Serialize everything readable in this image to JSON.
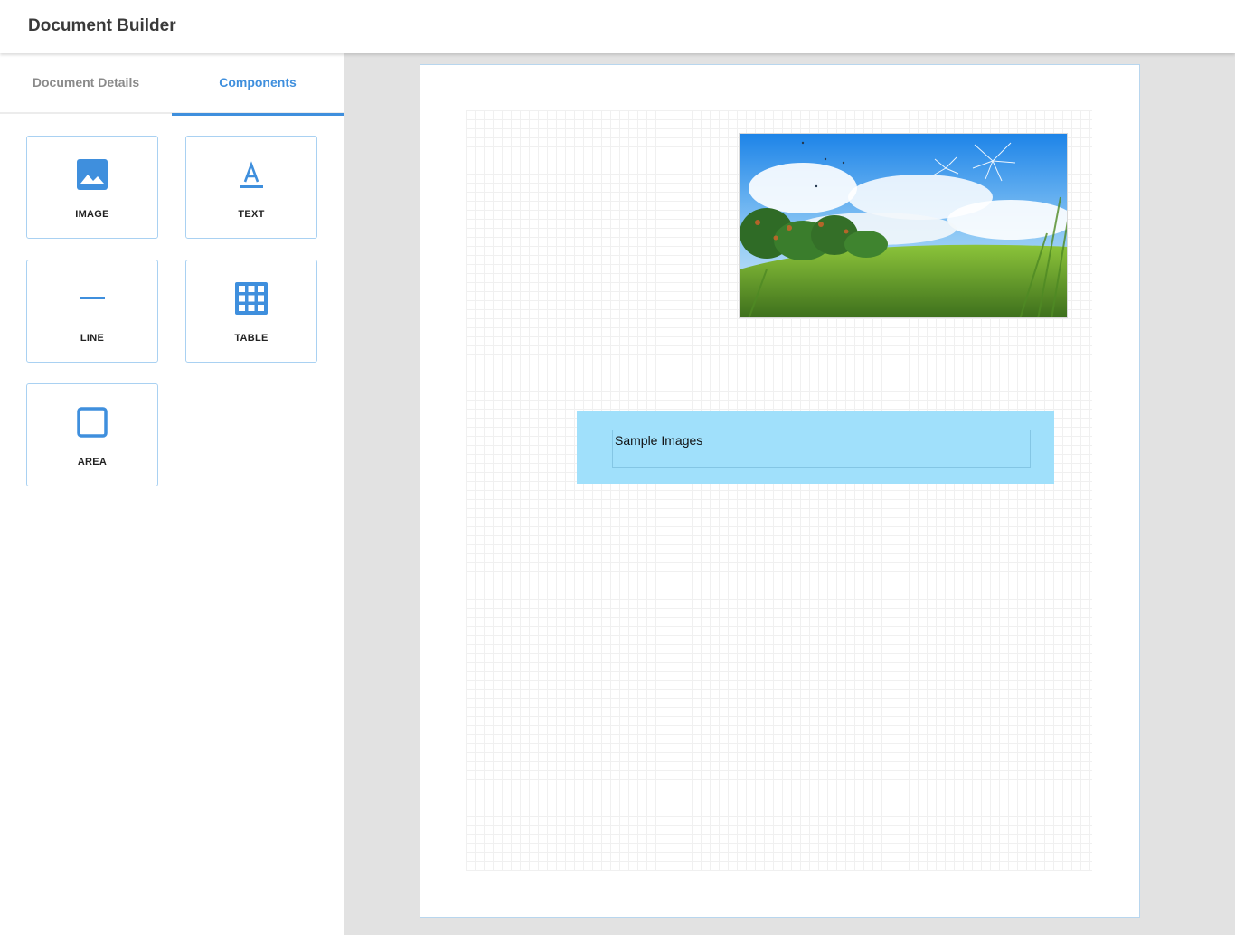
{
  "header": {
    "title": "Document Builder"
  },
  "sidebar": {
    "tabs": [
      {
        "label": "Document Details",
        "active": false
      },
      {
        "label": "Components",
        "active": true
      }
    ],
    "components": [
      {
        "label": "IMAGE",
        "icon": "image-icon"
      },
      {
        "label": "TEXT",
        "icon": "text-format-icon"
      },
      {
        "label": "LINE",
        "icon": "line-icon"
      },
      {
        "label": "TABLE",
        "icon": "table-grid-icon"
      },
      {
        "label": "AREA",
        "icon": "area-square-icon"
      }
    ]
  },
  "canvas": {
    "image_component": {
      "alt": "landscape-image"
    },
    "text_component": {
      "value": "Sample Images"
    }
  },
  "colors": {
    "accent": "#3f8fdd",
    "text_area_bg": "#a0e0fb",
    "card_border": "#a9d1f2"
  }
}
